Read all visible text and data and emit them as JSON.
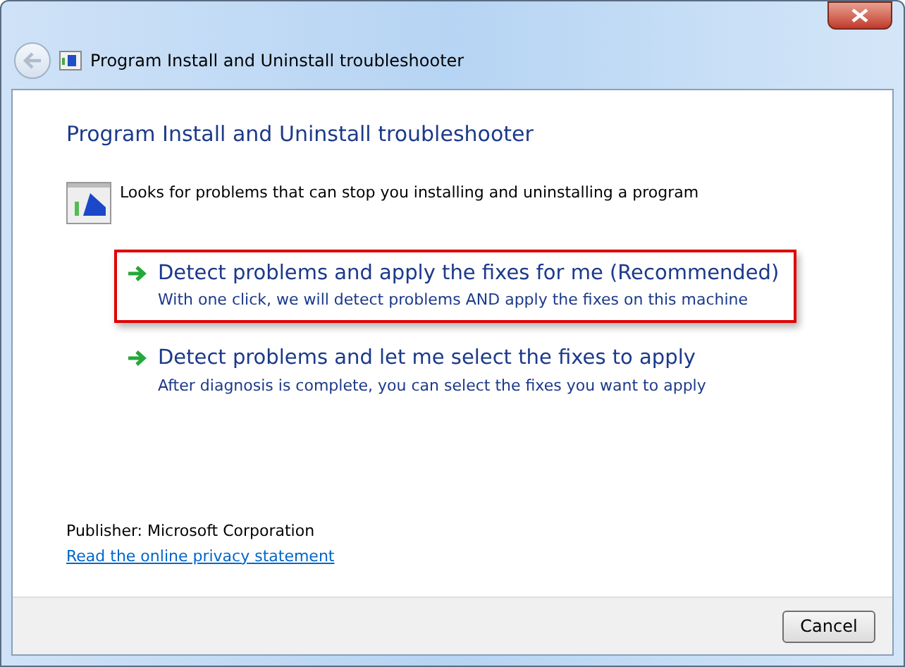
{
  "window": {
    "title": "Program Install and Uninstall troubleshooter"
  },
  "heading": "Program Install and Uninstall troubleshooter",
  "description": "Looks for problems that can stop you installing and uninstalling a program",
  "options": [
    {
      "title": "Detect problems and apply the fixes for me (Recommended)",
      "subtitle": "With one click, we will detect problems AND apply the fixes on this machine",
      "highlighted": true
    },
    {
      "title": "Detect problems and let me select the fixes to apply",
      "subtitle": "After diagnosis is complete, you can select the fixes you want to apply",
      "highlighted": false
    }
  ],
  "publisher": "Publisher: Microsoft Corporation",
  "privacy_link": "Read the online privacy statement",
  "buttons": [
    "Cancel"
  ]
}
